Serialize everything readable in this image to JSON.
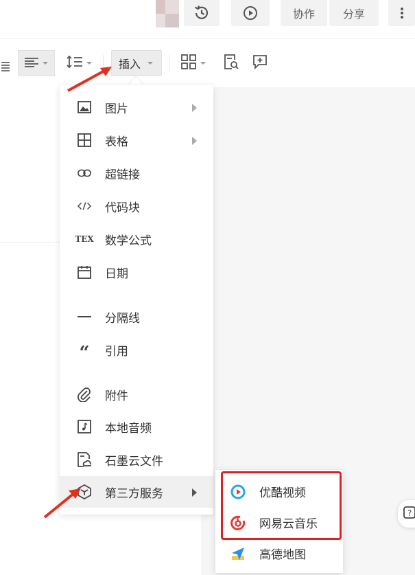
{
  "header": {
    "buttons": {
      "history_icon": "history-icon",
      "play_icon": "play-icon",
      "collab_label": "协作",
      "share_label": "分享",
      "more_icon": "more-icon"
    }
  },
  "toolbar": {
    "insert_label": "插入",
    "align_icon": "align-left-icon",
    "line_height_icon": "line-height-icon",
    "grid_icon": "grid-icon",
    "search_doc_icon": "doc-search-icon",
    "comment_icon": "comment-add-icon"
  },
  "insert_menu": {
    "items": [
      {
        "label": "图片",
        "icon": "image-icon",
        "has_submenu": true
      },
      {
        "label": "表格",
        "icon": "table-icon",
        "has_submenu": true
      },
      {
        "label": "超链接",
        "icon": "link-icon",
        "has_submenu": false
      },
      {
        "label": "代码块",
        "icon": "code-icon",
        "has_submenu": false
      },
      {
        "label": "数学公式",
        "icon": "tex-icon",
        "icon_text": "TEX",
        "has_submenu": false
      },
      {
        "label": "日期",
        "icon": "calendar-icon",
        "has_submenu": false
      },
      {
        "label": "分隔线",
        "icon": "divider-icon",
        "has_submenu": false
      },
      {
        "label": "引用",
        "icon": "quote-icon",
        "icon_text": "“",
        "has_submenu": false
      },
      {
        "label": "附件",
        "icon": "paperclip-icon",
        "has_submenu": false
      },
      {
        "label": "本地音频",
        "icon": "audio-file-icon",
        "has_submenu": false
      },
      {
        "label": "石墨云文件",
        "icon": "cloud-file-icon",
        "has_submenu": false
      },
      {
        "label": "第三方服务",
        "icon": "third-party-icon",
        "has_submenu": true,
        "active": true
      }
    ]
  },
  "third_party_submenu": {
    "items": [
      {
        "label": "优酷视频",
        "icon": "youku-icon",
        "color": "#1fa8e8"
      },
      {
        "label": "网易云音乐",
        "icon": "netease-music-icon",
        "color": "#e03c31"
      },
      {
        "label": "高德地图",
        "icon": "amap-icon",
        "color": "#2a8ef0"
      }
    ]
  },
  "colors": {
    "highlight_box": "#e02020",
    "annotation_arrow": "#e03020",
    "menu_active_bg": "#f0f0f0"
  }
}
